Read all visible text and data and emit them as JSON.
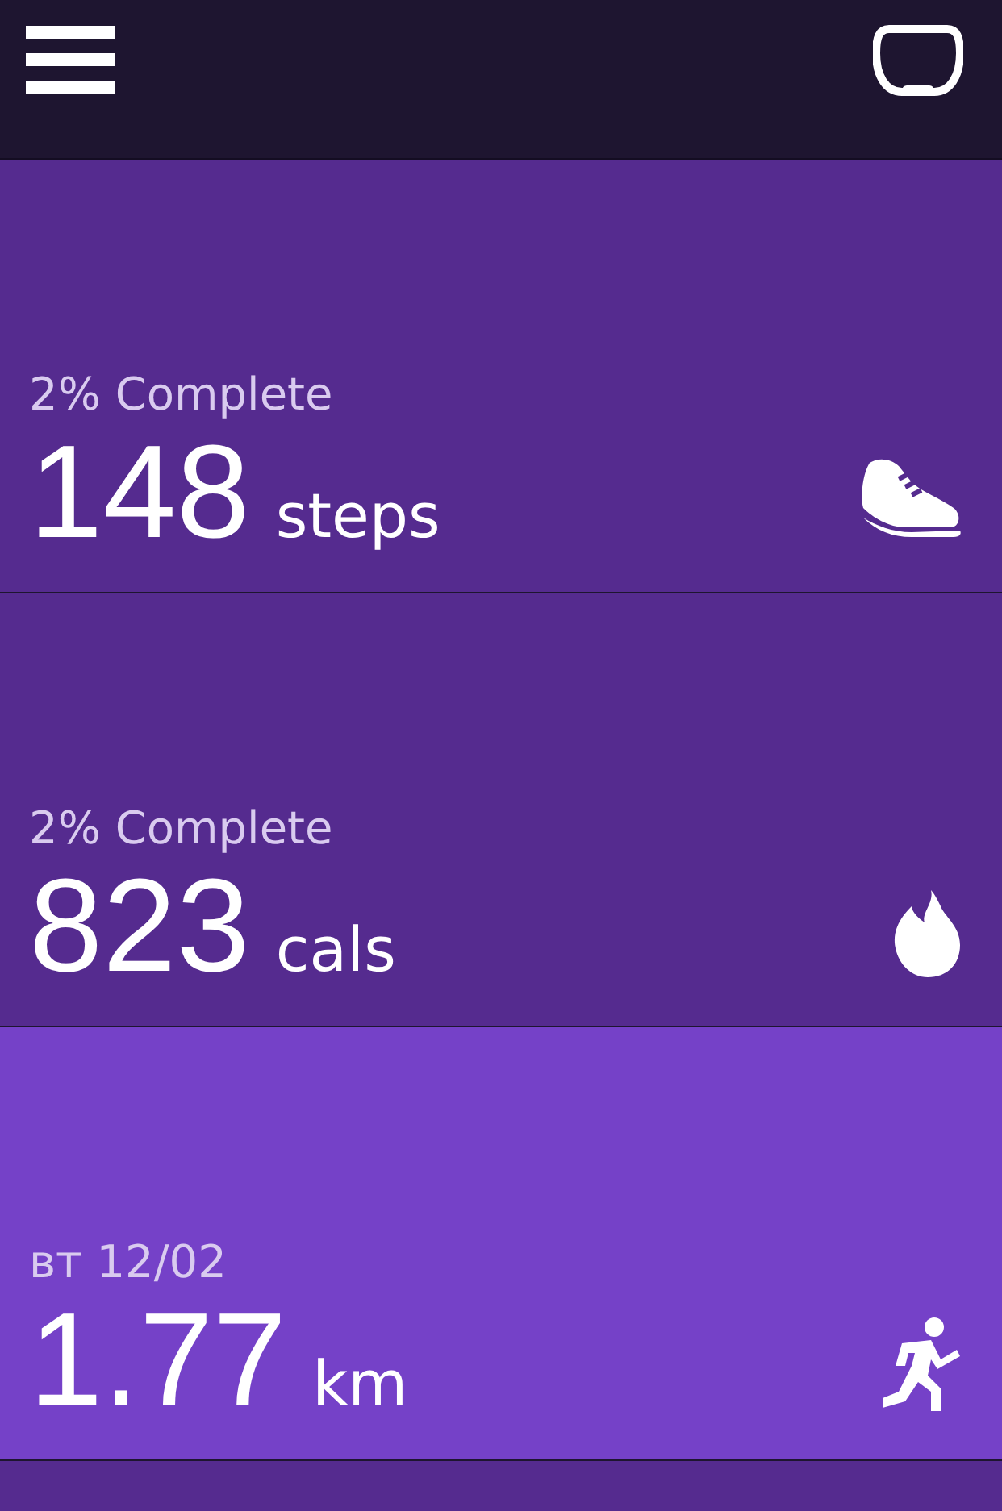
{
  "tiles": [
    {
      "kind": "steps",
      "caption": "2% Complete",
      "value": "148",
      "unit": "steps",
      "selected": false
    },
    {
      "kind": "calories",
      "caption": "2% Complete",
      "value": "823",
      "unit": "cals",
      "selected": false
    },
    {
      "kind": "distance",
      "caption": "вт 12/02",
      "value": "1.77",
      "unit": "km",
      "selected": true
    }
  ]
}
